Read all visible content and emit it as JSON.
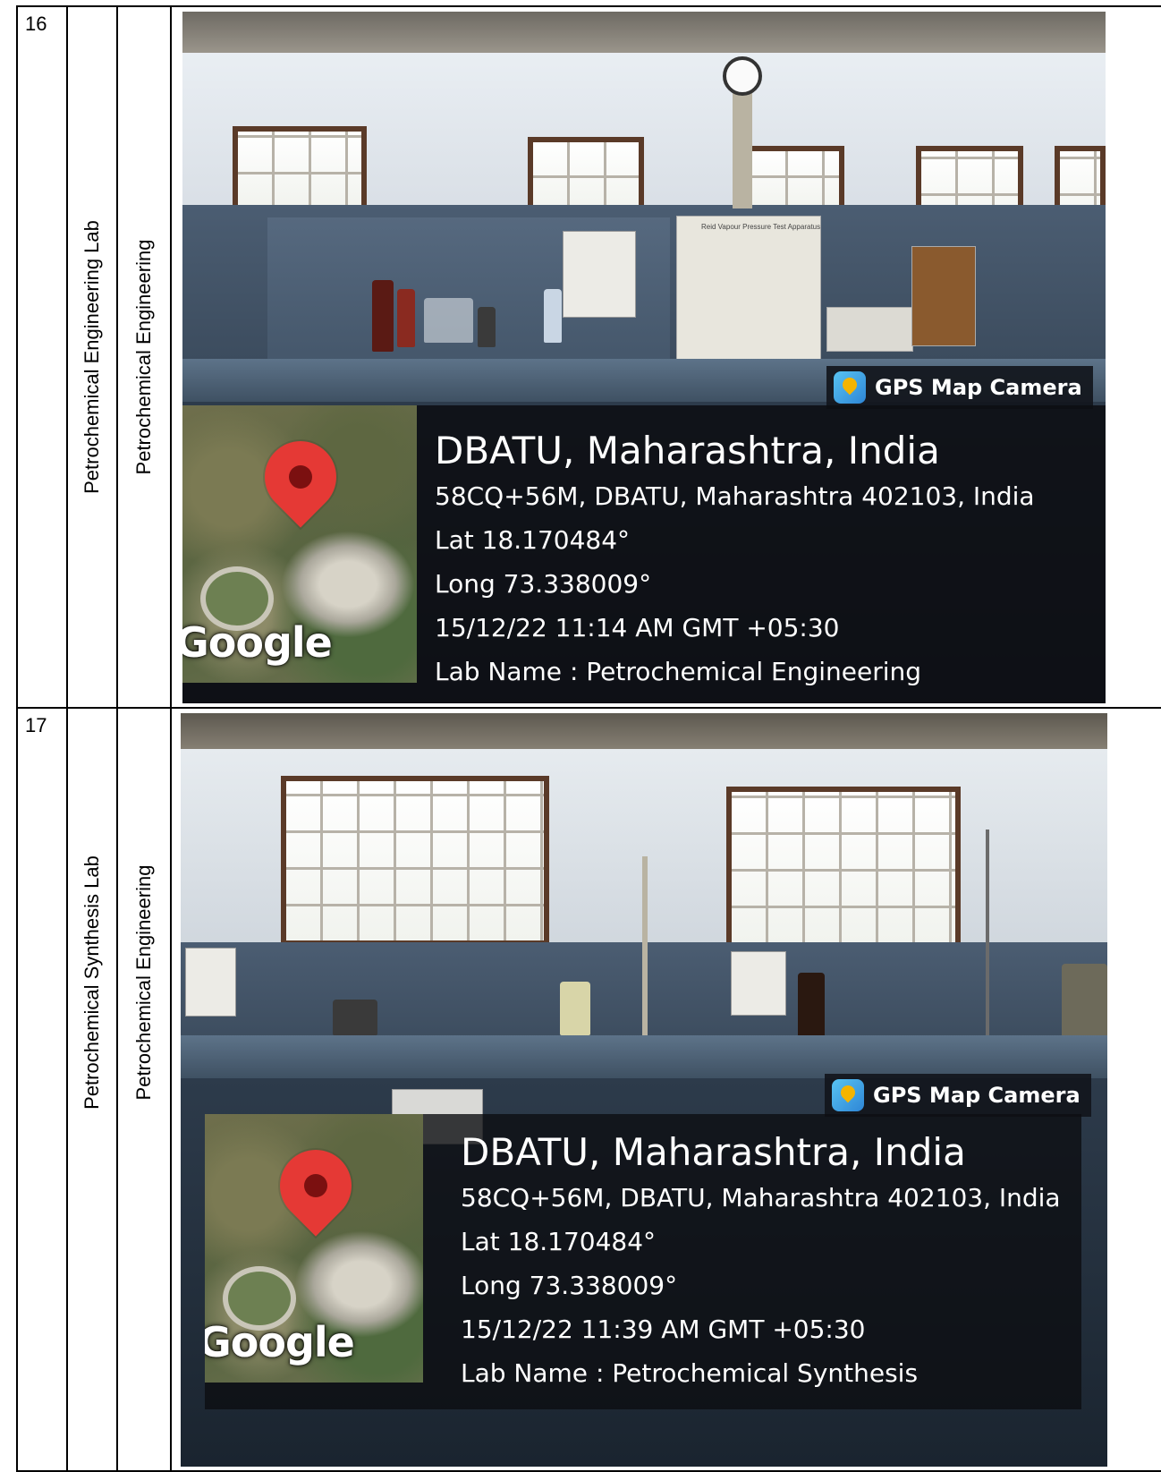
{
  "rows": [
    {
      "sr_no": "16",
      "lab_name": "Petrochemical Engineering Lab",
      "department": "Petrochemical Engineering",
      "photo": {
        "app_tag": "GPS Map Camera",
        "map_logo": "Google",
        "place": "DBATU, Maharashtra, India",
        "address": "58CQ+56M, DBATU, Maharashtra 402103, India",
        "lat": "Lat 18.170484°",
        "long": "Long 73.338009°",
        "datetime": "15/12/22 11:14 AM GMT +05:30",
        "lab_line": "Lab Name : Petrochemical Engineering",
        "equipment_label": "Reid Vapour Pressure Test Apparatus"
      }
    },
    {
      "sr_no": "17",
      "lab_name": "Petrochemical Synthesis Lab",
      "department": "Petrochemical Engineering",
      "photo": {
        "app_tag": "GPS Map Camera",
        "map_logo": "Google",
        "place": "DBATU, Maharashtra, India",
        "address": "58CQ+56M, DBATU, Maharashtra 402103, India",
        "lat": "Lat 18.170484°",
        "long": "Long 73.338009°",
        "datetime": "15/12/22 11:39 AM GMT +05:30",
        "lab_line": "Lab Name : Petrochemical Synthesis"
      }
    }
  ]
}
